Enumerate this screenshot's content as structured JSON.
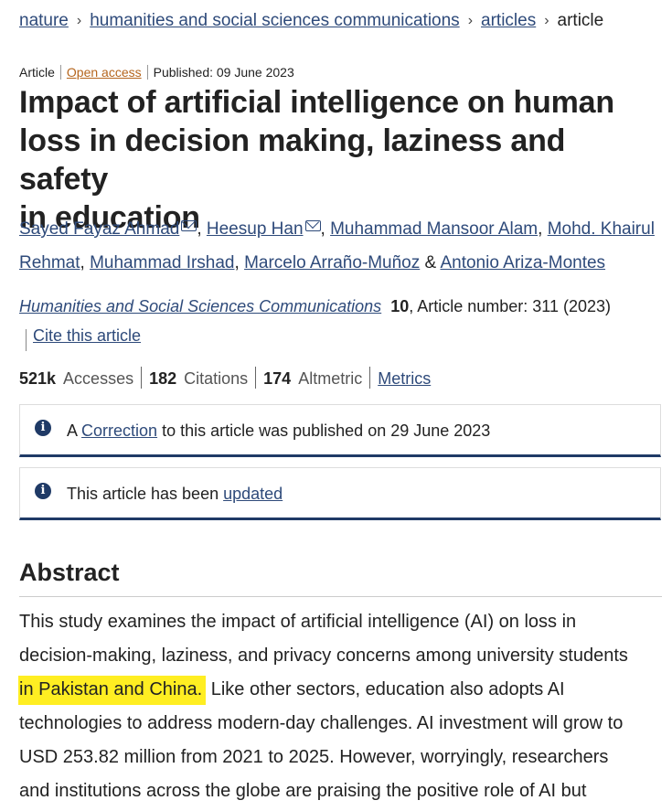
{
  "breadcrumb": {
    "items": [
      "nature",
      "humanities and social sciences communications",
      "articles"
    ],
    "current": "article"
  },
  "meta": {
    "type": "Article",
    "access": "Open access",
    "published": "Published: 09 June 2023"
  },
  "title": {
    "line1": "Impact of artificial intelligence on human",
    "line2": "loss in decision making, laziness and safety",
    "line3": "in education"
  },
  "authors": {
    "a1": "Sayed Fayaz Ahmad",
    "a2": "Heesup Han",
    "a3": "Muhammad Mansoor Alam",
    "a4": "Mohd. Khairul",
    "a4b": "Rehmat",
    "a5": "Muhammad Irshad",
    "a6": "Marcelo Arraño-Muñoz",
    "and": "&",
    "a7": "Antonio Ariza-Montes",
    "comma": ","
  },
  "journal": {
    "name": "Humanities and Social Sciences Communications",
    "volume": "10",
    "details": ", Article number: 311 (2023)",
    "cite_label": "Cite this article"
  },
  "metrics": {
    "accesses_value": "521k",
    "accesses_label": "Accesses",
    "citations_value": "182",
    "citations_label": "Citations",
    "altmetric_value": "174",
    "altmetric_label": "Altmetric",
    "metrics_link": "Metrics"
  },
  "notices": {
    "correction_prefix": "A",
    "correction_link": "Correction",
    "correction_suffix": "to this article was published on 29 June 2023",
    "updated_prefix": "This article has been",
    "updated_link": "updated"
  },
  "abstract": {
    "heading": "Abstract",
    "line1": "This study examines the impact of artificial intelligence (AI) on loss in",
    "line2": "decision-making, laziness, and privacy concerns among university students",
    "line3_highlight": "in Pakistan and China.",
    "line3_rest": "Like other sectors, education also adopts AI",
    "line4": "technologies to address modern-day challenges. AI investment will grow to",
    "line5": "USD 253.82 million from 2021 to 2025. However, worryingly, researchers",
    "line6": "and institutions across the globe are praising the positive role of AI but"
  },
  "colors": {
    "link": "#2e4a7a",
    "open_access": "#b5651d",
    "highlight": "#ffee22",
    "notice_border": "#1f3a66"
  },
  "icons": [
    "chevron-right-icon",
    "mail-icon",
    "info-icon"
  ]
}
